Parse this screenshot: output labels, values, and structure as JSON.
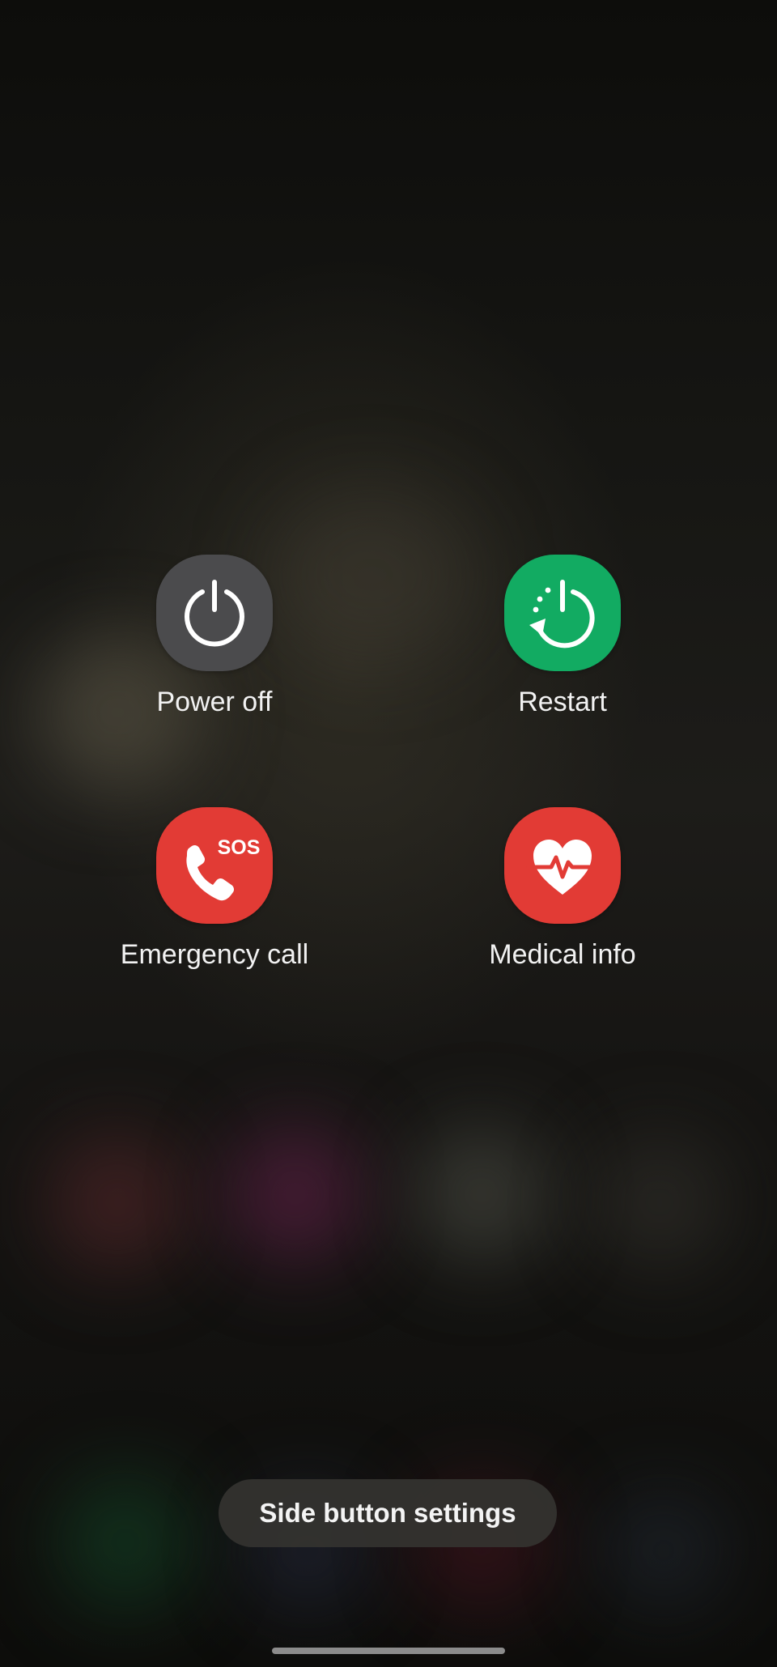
{
  "power_menu": {
    "options": [
      {
        "id": "power-off",
        "label": "Power off",
        "icon": "power-icon",
        "color": "#4b4b4d"
      },
      {
        "id": "restart",
        "label": "Restart",
        "icon": "restart-icon",
        "color": "#12ab62"
      },
      {
        "id": "emergency-call",
        "label": "Emergency call",
        "icon": "sos-phone-icon",
        "icon_text": "SOS",
        "color": "#e23b35"
      },
      {
        "id": "medical-info",
        "label": "Medical info",
        "icon": "heart-pulse-icon",
        "color": "#e23b35"
      }
    ],
    "side_button_settings_label": "Side button settings"
  }
}
